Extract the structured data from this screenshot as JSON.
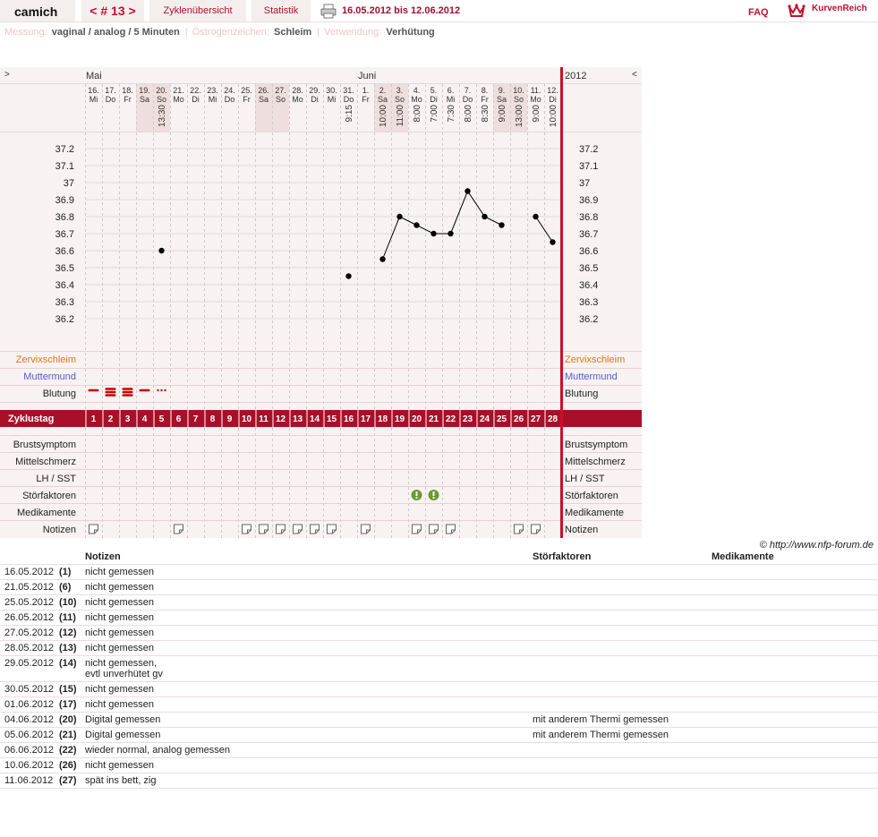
{
  "header": {
    "user": "camich",
    "cycle": "< # 13 >",
    "tab_overview": "Zyklenübersicht",
    "tab_stats": "Statistik",
    "date_range": "16.05.2012 bis 12.06.2012",
    "faq": "FAQ",
    "brand": "KurvenReich"
  },
  "info": {
    "messung_label": "Messung:",
    "messung_value": "vaginal / analog / 5 Minuten",
    "oestrogen_label": "Östrogenzeichen:",
    "oestrogen_value": "Schleim",
    "verwendung_label": "Verwendung:",
    "verwendung_value": "Verhütung"
  },
  "chart_nav": {
    "prev": ">",
    "next": "<",
    "year": "2012",
    "month1": "Mai",
    "month2": "Juni"
  },
  "days": [
    {
      "d": "16.",
      "w": "Mi",
      "t": "",
      "we": false
    },
    {
      "d": "17.",
      "w": "Do",
      "t": "",
      "we": false
    },
    {
      "d": "18.",
      "w": "Fr",
      "t": "",
      "we": false
    },
    {
      "d": "19.",
      "w": "Sa",
      "t": "",
      "we": true
    },
    {
      "d": "20.",
      "w": "So",
      "t": "13:30",
      "we": true
    },
    {
      "d": "21.",
      "w": "Mo",
      "t": "",
      "we": false
    },
    {
      "d": "22.",
      "w": "Di",
      "t": "",
      "we": false
    },
    {
      "d": "23.",
      "w": "Mi",
      "t": "",
      "we": false
    },
    {
      "d": "24.",
      "w": "Do",
      "t": "",
      "we": false
    },
    {
      "d": "25.",
      "w": "Fr",
      "t": "",
      "we": false
    },
    {
      "d": "26.",
      "w": "Sa",
      "t": "",
      "we": true
    },
    {
      "d": "27.",
      "w": "So",
      "t": "",
      "we": true
    },
    {
      "d": "28.",
      "w": "Mo",
      "t": "",
      "we": false
    },
    {
      "d": "29.",
      "w": "Di",
      "t": "",
      "we": false
    },
    {
      "d": "30.",
      "w": "Mi",
      "t": "",
      "we": false
    },
    {
      "d": "31.",
      "w": "Do",
      "t": "9:15",
      "we": false
    },
    {
      "d": "1.",
      "w": "Fr",
      "t": "",
      "we": false
    },
    {
      "d": "2.",
      "w": "Sa",
      "t": "10:00",
      "we": true
    },
    {
      "d": "3.",
      "w": "So",
      "t": "11:00",
      "we": true
    },
    {
      "d": "4.",
      "w": "Mo",
      "t": "8:00",
      "we": false
    },
    {
      "d": "5.",
      "w": "Di",
      "t": "7:00",
      "we": false
    },
    {
      "d": "6.",
      "w": "Mi",
      "t": "7:30",
      "we": false
    },
    {
      "d": "7.",
      "w": "Do",
      "t": "8:00",
      "we": false
    },
    {
      "d": "8.",
      "w": "Fr",
      "t": "8:30",
      "we": false
    },
    {
      "d": "9.",
      "w": "Sa",
      "t": "9:00",
      "we": true
    },
    {
      "d": "10.",
      "w": "So",
      "t": "13:00",
      "we": true
    },
    {
      "d": "11.",
      "w": "Mo",
      "t": "9:00",
      "we": false
    },
    {
      "d": "12.",
      "w": "Di",
      "t": "10:00",
      "we": false
    }
  ],
  "chart_data": {
    "type": "line",
    "ylim": [
      36.1,
      37.3
    ],
    "yticks": [
      "37.2",
      "37.1",
      "37",
      "36.9",
      "36.8",
      "36.7",
      "36.6",
      "36.5",
      "36.4",
      "36.3",
      "36.2"
    ],
    "x": [
      "16.05",
      "17.05",
      "18.05",
      "19.05",
      "20.05",
      "21.05",
      "22.05",
      "23.05",
      "24.05",
      "25.05",
      "26.05",
      "27.05",
      "28.05",
      "29.05",
      "30.05",
      "31.05",
      "01.06",
      "02.06",
      "03.06",
      "04.06",
      "05.06",
      "06.06",
      "07.06",
      "08.06",
      "09.06",
      "10.06",
      "11.06",
      "12.06"
    ],
    "temperature": [
      null,
      null,
      null,
      null,
      36.6,
      null,
      null,
      null,
      null,
      null,
      null,
      null,
      null,
      null,
      null,
      36.45,
      null,
      36.55,
      36.8,
      36.75,
      36.7,
      36.7,
      36.95,
      36.8,
      36.75,
      null,
      36.8,
      36.65
    ],
    "line_segments": [
      [
        17,
        24
      ],
      [
        26,
        27
      ]
    ]
  },
  "rows_top": {
    "zervix": "Zervixschleim",
    "muttermund": "Muttermund",
    "blutung": "Blutung"
  },
  "bleeding": [
    1,
    3,
    3,
    1,
    "s",
    0,
    0,
    0,
    0,
    0,
    0,
    0,
    0,
    0,
    0,
    0,
    0,
    0,
    0,
    0,
    0,
    0,
    0,
    0,
    0,
    0,
    0,
    0
  ],
  "zyklustag_label": "Zyklustag",
  "zyklustage": [
    "1",
    "2",
    "3",
    "4",
    "5",
    "6",
    "7",
    "8",
    "9",
    "10",
    "11",
    "12",
    "13",
    "14",
    "15",
    "16",
    "17",
    "18",
    "19",
    "20",
    "21",
    "22",
    "23",
    "24",
    "25",
    "26",
    "27",
    "28"
  ],
  "rows_bottom": {
    "brust": "Brustsymptom",
    "mittel": "Mittelschmerz",
    "lh": "LH / SST",
    "stoer": "Störfaktoren",
    "medi": "Medikamente",
    "notizen": "Notizen"
  },
  "stoer_days": [
    19,
    20
  ],
  "note_days": [
    0,
    5,
    9,
    10,
    11,
    12,
    13,
    14,
    16,
    19,
    20,
    21,
    25,
    26
  ],
  "colors": {
    "accent": "#a8102a",
    "zervix": "#e07810",
    "muttermund": "#5060c8",
    "stoer": "#6a9a30"
  },
  "notes": {
    "copyright": "© http://www.nfp-forum.de",
    "col_notes": "Notizen",
    "col_stoer": "Störfaktoren",
    "col_medi": "Medikamente",
    "rows": [
      {
        "date": "16.05.2012",
        "day": "(1)",
        "note": "nicht gemessen",
        "stoer": "",
        "medi": ""
      },
      {
        "date": "21.05.2012",
        "day": "(6)",
        "note": "nicht gemessen",
        "stoer": "",
        "medi": ""
      },
      {
        "date": "25.05.2012",
        "day": "(10)",
        "note": "nicht gemessen",
        "stoer": "",
        "medi": ""
      },
      {
        "date": "26.05.2012",
        "day": "(11)",
        "note": "nicht gemessen",
        "stoer": "",
        "medi": ""
      },
      {
        "date": "27.05.2012",
        "day": "(12)",
        "note": "nicht gemessen",
        "stoer": "",
        "medi": ""
      },
      {
        "date": "28.05.2012",
        "day": "(13)",
        "note": "nicht gemessen",
        "stoer": "",
        "medi": ""
      },
      {
        "date": "29.05.2012",
        "day": "(14)",
        "note": "nicht gemessen,\nevtl unverhütet gv",
        "stoer": "",
        "medi": ""
      },
      {
        "date": "30.05.2012",
        "day": "(15)",
        "note": "nicht gemessen",
        "stoer": "",
        "medi": ""
      },
      {
        "date": "01.06.2012",
        "day": "(17)",
        "note": "nicht gemessen",
        "stoer": "",
        "medi": ""
      },
      {
        "date": "04.06.2012",
        "day": "(20)",
        "note": "Digital gemessen",
        "stoer": "mit anderem Thermi gemessen",
        "medi": ""
      },
      {
        "date": "05.06.2012",
        "day": "(21)",
        "note": "Digital gemessen",
        "stoer": "mit anderem Thermi gemessen",
        "medi": ""
      },
      {
        "date": "06.06.2012",
        "day": "(22)",
        "note": "wieder normal, analog gemessen",
        "stoer": "",
        "medi": ""
      },
      {
        "date": "10.06.2012",
        "day": "(26)",
        "note": "nicht gemessen",
        "stoer": "",
        "medi": ""
      },
      {
        "date": "11.06.2012",
        "day": "(27)",
        "note": "spät ins bett, zig",
        "stoer": "",
        "medi": ""
      }
    ]
  }
}
